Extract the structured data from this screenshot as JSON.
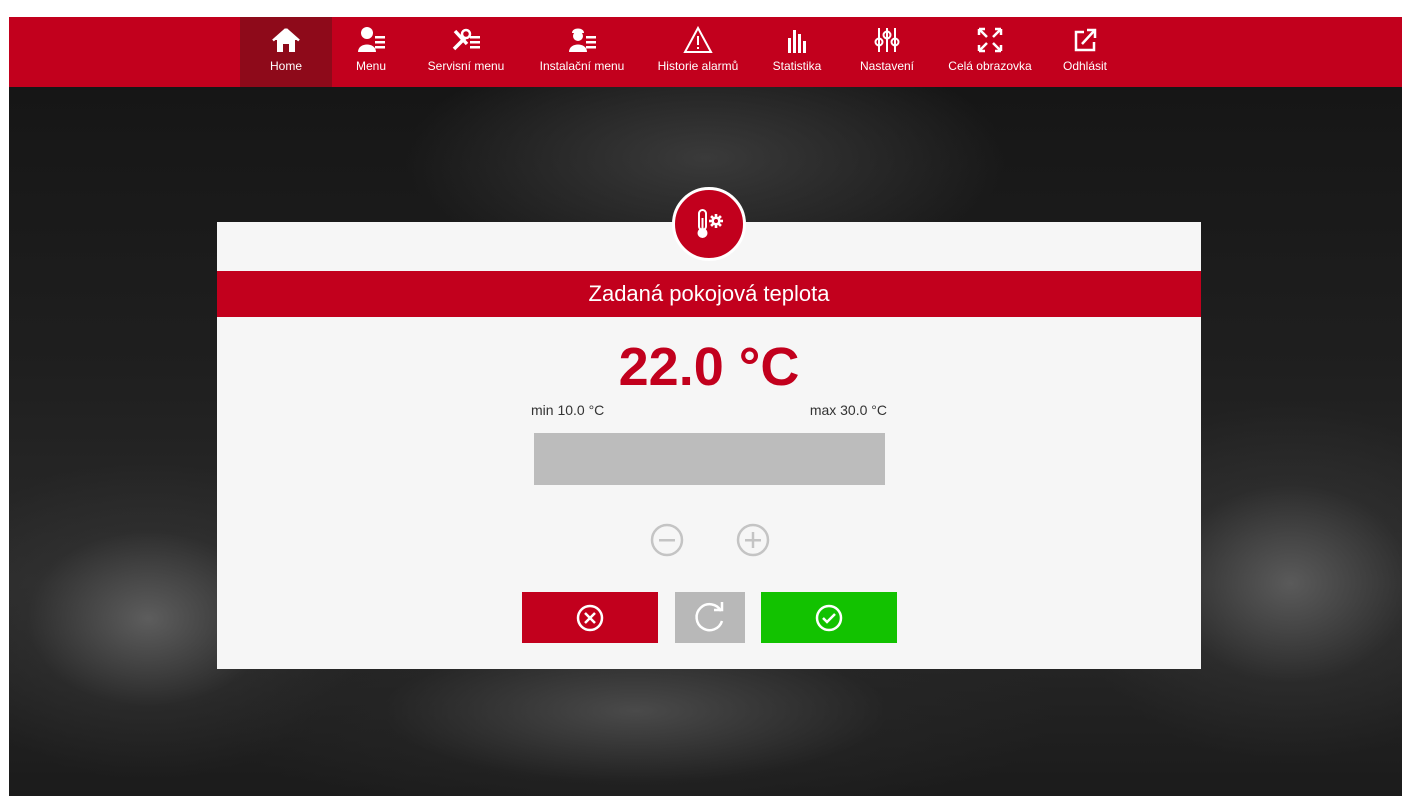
{
  "nav": {
    "items": [
      {
        "label": "Home",
        "icon": "home-icon",
        "active": true
      },
      {
        "label": "Menu",
        "icon": "user-menu-icon"
      },
      {
        "label": "Servisní menu",
        "icon": "service-tools-icon"
      },
      {
        "label": "Instalační menu",
        "icon": "installer-icon"
      },
      {
        "label": "Historie alarmů",
        "icon": "warning-icon"
      },
      {
        "label": "Statistika",
        "icon": "statistics-icon"
      },
      {
        "label": "Nastavení",
        "icon": "sliders-icon"
      },
      {
        "label": "Celá obrazovka",
        "icon": "fullscreen-icon"
      },
      {
        "label": "Odhlásit",
        "icon": "logout-icon"
      }
    ]
  },
  "dialog": {
    "icon": "thermometer-gear-icon",
    "title": "Zadaná pokojová teplota",
    "value": "22.0 °C",
    "min_label": "min 10.0 °C",
    "max_label": "max 30.0 °C",
    "decrease_icon": "minus-circle-icon",
    "increase_icon": "plus-circle-icon",
    "cancel_icon": "close-circle-icon",
    "reset_icon": "refresh-icon",
    "confirm_icon": "check-circle-icon"
  },
  "colors": {
    "brand_red": "#c2001d",
    "active_nav": "#8e0a1a",
    "confirm_green": "#12c200",
    "neutral_gray": "#b8b8b8"
  }
}
